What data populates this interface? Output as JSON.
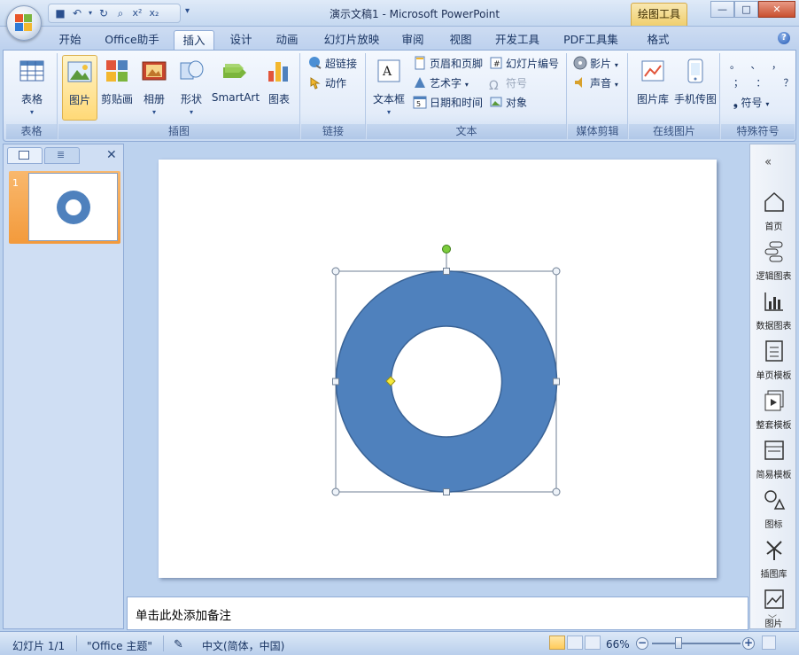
{
  "window": {
    "title": "演示文稿1 - Microsoft PowerPoint",
    "contextual_tab": "绘图工具",
    "buttons": {
      "minimize": "—",
      "maximize": "□",
      "close": "✕"
    }
  },
  "tabs": [
    {
      "label": "开始"
    },
    {
      "label": "Office助手"
    },
    {
      "label": "插入",
      "active": true
    },
    {
      "label": "设计"
    },
    {
      "label": "动画"
    },
    {
      "label": "幻灯片放映"
    },
    {
      "label": "审阅"
    },
    {
      "label": "视图"
    },
    {
      "label": "开发工具"
    },
    {
      "label": "PDF工具集"
    },
    {
      "label": "格式"
    }
  ],
  "ribbon": {
    "groups": {
      "table": {
        "label": "表格",
        "table_btn": "表格"
      },
      "illustrations": {
        "label": "插图",
        "picture": "图片",
        "clipart": "剪贴画",
        "album": "相册",
        "shapes": "形状",
        "smartart": "SmartArt",
        "chart": "图表"
      },
      "links": {
        "label": "链接",
        "hyperlink": "超链接",
        "action": "动作"
      },
      "text": {
        "label": "文本",
        "textbox": "文本框",
        "header_footer": "页眉和页脚",
        "wordart": "艺术字",
        "datetime": "日期和时间",
        "slide_number": "幻灯片编号",
        "symbol": "符号",
        "object": "对象"
      },
      "media": {
        "label": "媒体剪辑",
        "movie": "影片",
        "sound": "声音"
      },
      "online_pictures": {
        "label": "在线图片",
        "gallery": "图片库",
        "phone": "手机传图"
      },
      "special_symbols": {
        "label": "特殊符号",
        "symbol": "符号",
        "chars": [
          "。",
          "、",
          "；",
          "：",
          "？",
          "，"
        ]
      }
    }
  },
  "slides_pane": {
    "slide_number": "1"
  },
  "slide": {
    "shape": {
      "type": "donut",
      "fill": "#4f81bd",
      "stroke": "#3a6396"
    }
  },
  "notes": {
    "placeholder": "单击此处添加备注"
  },
  "right_toolbar": {
    "items": [
      {
        "label": "首页"
      },
      {
        "label": "逻辑图表"
      },
      {
        "label": "数据图表"
      },
      {
        "label": "单页模板"
      },
      {
        "label": "整套模板"
      },
      {
        "label": "简易模板"
      },
      {
        "label": "图标"
      },
      {
        "label": "插图库"
      },
      {
        "label": "图片"
      }
    ]
  },
  "status": {
    "slide_info": "幻灯片 1/1",
    "theme": "\"Office 主题\"",
    "language": "中文(简体，中国)",
    "zoom": "66%"
  },
  "colors": {
    "accent": "#4f81bd",
    "ribbon_bg": "#dbe6f6",
    "workspace_bg": "#bcd2ee"
  }
}
